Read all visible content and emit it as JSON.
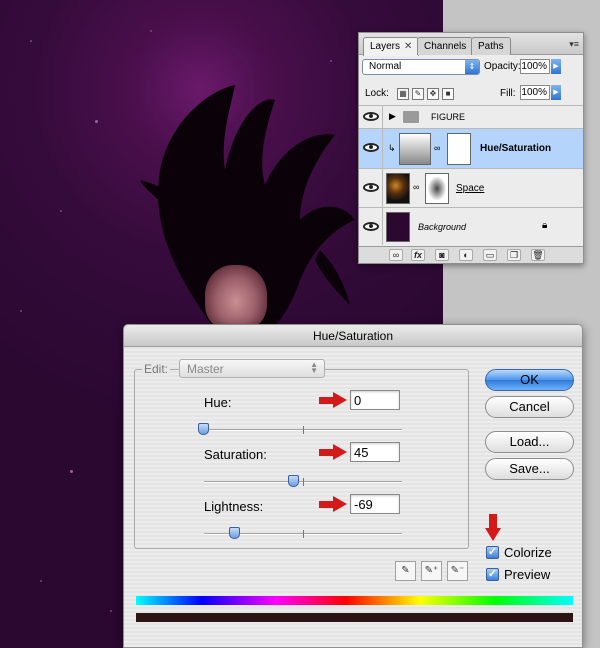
{
  "layers_panel": {
    "tabs": [
      "Layers",
      "Channels",
      "Paths"
    ],
    "tab_close": "✕",
    "blend_mode": "Normal",
    "opacity_label": "Opacity:",
    "opacity_value": "100%",
    "lock_label": "Lock:",
    "fill_label": "Fill:",
    "fill_value": "100%",
    "layers": [
      {
        "name": "FIGURE",
        "kind": "group"
      },
      {
        "name": "Hue/Saturation",
        "kind": "adjustment"
      },
      {
        "name": "Space",
        "kind": "image"
      },
      {
        "name": "Background",
        "kind": "background"
      }
    ]
  },
  "dialog": {
    "title": "Hue/Saturation",
    "edit_label": "Edit:",
    "edit_value": "Master",
    "hue_label": "Hue:",
    "hue_value": "0",
    "saturation_label": "Saturation:",
    "saturation_value": "45",
    "lightness_label": "Lightness:",
    "lightness_value": "-69",
    "buttons": {
      "ok": "OK",
      "cancel": "Cancel",
      "load": "Load...",
      "save": "Save..."
    },
    "colorize_label": "Colorize",
    "colorize_checked": true,
    "preview_label": "Preview",
    "preview_checked": true,
    "checkmark": "✓"
  },
  "colors": {
    "canvas_purple": "#350b3b",
    "arrow_red": "#d41919",
    "selected_layer": "#b5d4fb",
    "result_bar": "#2c1414"
  }
}
